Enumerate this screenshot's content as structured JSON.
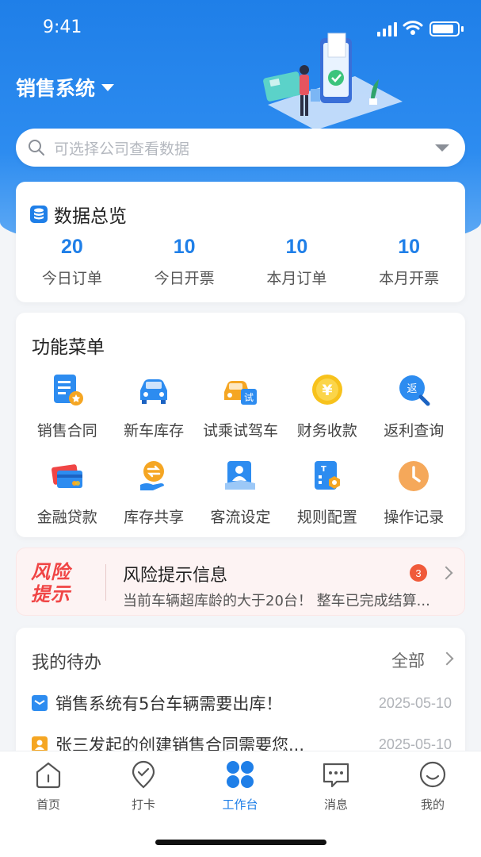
{
  "status_bar": {
    "time": "9:41"
  },
  "header": {
    "system_title": "销售系统"
  },
  "search": {
    "placeholder": "可选择公司查看数据"
  },
  "overview": {
    "title": "数据总览",
    "stats": [
      {
        "value": "20",
        "label": "今日订单"
      },
      {
        "value": "10",
        "label": "今日开票"
      },
      {
        "value": "10",
        "label": "本月订单"
      },
      {
        "value": "10",
        "label": "本月开票"
      }
    ]
  },
  "menu": {
    "title": "功能菜单",
    "items": [
      {
        "label": "销售合同",
        "icon": "contract-icon"
      },
      {
        "label": "新车库存",
        "icon": "car-icon"
      },
      {
        "label": "试乘试驾车",
        "icon": "test-drive-icon"
      },
      {
        "label": "财务收款",
        "icon": "yen-coin-icon"
      },
      {
        "label": "返利查询",
        "icon": "rebate-search-icon"
      },
      {
        "label": "金融贷款",
        "icon": "bank-card-icon"
      },
      {
        "label": "库存共享",
        "icon": "share-icon"
      },
      {
        "label": "客流设定",
        "icon": "customer-icon"
      },
      {
        "label": "规则配置",
        "icon": "rules-icon"
      },
      {
        "label": "操作记录",
        "icon": "clock-icon"
      }
    ]
  },
  "risk": {
    "logo": [
      "风险",
      "提示"
    ],
    "title": "风险提示信息",
    "text": "当前车辆超库龄的大于20台！ 整车已完成结算...",
    "badge": "3"
  },
  "todo": {
    "title": "我的待办",
    "all": "全部",
    "items": [
      {
        "text": "销售系统有5台车辆需要出库！",
        "date": "2025-05-10",
        "icon_color": "#2d8cf0"
      },
      {
        "text": "张三发起的创建销售合同需要您...",
        "date": "2025-05-10",
        "icon_color": "#f5a623"
      }
    ]
  },
  "tabbar": {
    "active": 2,
    "tabs": [
      {
        "label": "首页",
        "icon": "home-icon"
      },
      {
        "label": "打卡",
        "icon": "check-in-icon"
      },
      {
        "label": "工作台",
        "icon": "workbench-icon"
      },
      {
        "label": "消息",
        "icon": "message-icon"
      },
      {
        "label": "我的",
        "icon": "profile-icon"
      }
    ]
  },
  "colors": {
    "primary": "#1f7fe8",
    "risk": "#f04545",
    "badge": "#f05a3a"
  }
}
